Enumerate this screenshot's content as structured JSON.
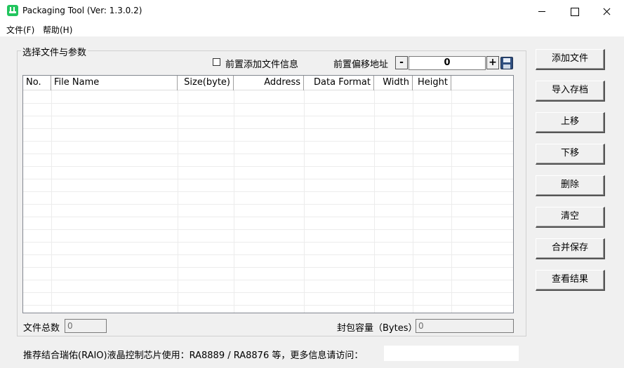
{
  "window": {
    "title": "Packaging Tool (Ver: 1.3.0.2)",
    "app_icon": "green-app-icon",
    "controls": [
      "minimize-icon",
      "maximize-icon",
      "close-icon"
    ]
  },
  "menubar": {
    "file": "文件(F)",
    "help": "帮助(H)"
  },
  "group": {
    "title": "选择文件与参数",
    "prepend_checkbox_label": "前置添加文件信息",
    "prepend_checked": false,
    "offset_label": "前置偏移地址",
    "offset_minus": "-",
    "offset_value": "0",
    "offset_plus": "+",
    "save_icon": "floppy-disk-icon"
  },
  "table": {
    "columns": [
      "No.",
      "File Name",
      "Size(byte)",
      "Address",
      "Data Format",
      "Width",
      "Height"
    ],
    "rows": []
  },
  "summary": {
    "file_count_label": "文件总数",
    "file_count_value": "0",
    "capacity_label": "封包容量（Bytes）",
    "capacity_value": "0"
  },
  "buttons": {
    "add_file": "添加文件",
    "import_archive": "导入存档",
    "move_up": "上移",
    "move_down": "下移",
    "delete": "删除",
    "clear": "清空",
    "merge_save": "合并保存",
    "view_result": "查看结果"
  },
  "footer": {
    "text": "推荐结合瑞佑(RAIO)液晶控制芯片使用：RA8889 / RA8876 等，更多信息请访问：",
    "link": ""
  }
}
